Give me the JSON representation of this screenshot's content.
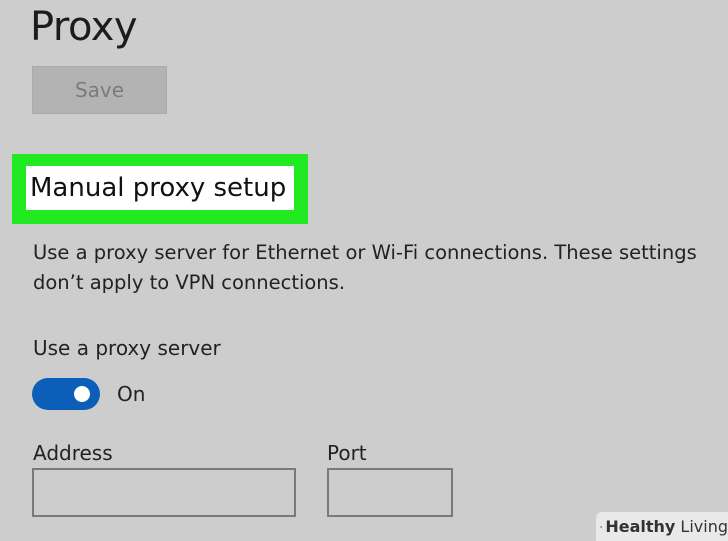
{
  "page": {
    "title": "Proxy"
  },
  "toolbar": {
    "save_label": "Save"
  },
  "manual_proxy": {
    "heading": "Manual proxy setup",
    "description": "Use a proxy server for Ethernet or Wi-Fi connections. These settings don’t apply to VPN connections.",
    "use_proxy_label": "Use a proxy server",
    "toggle_state": "On",
    "toggle_on": true,
    "address_label": "Address",
    "address_value": "",
    "port_label": "Port",
    "port_value": ""
  },
  "watermark": {
    "brand_bold": "Healthy",
    "brand_rest": " Living"
  },
  "colors": {
    "background": "#cdcdcd",
    "highlight": "#22ea22",
    "toggle_accent": "#0c5fb8",
    "button_disabled": "#b3b3b3"
  }
}
